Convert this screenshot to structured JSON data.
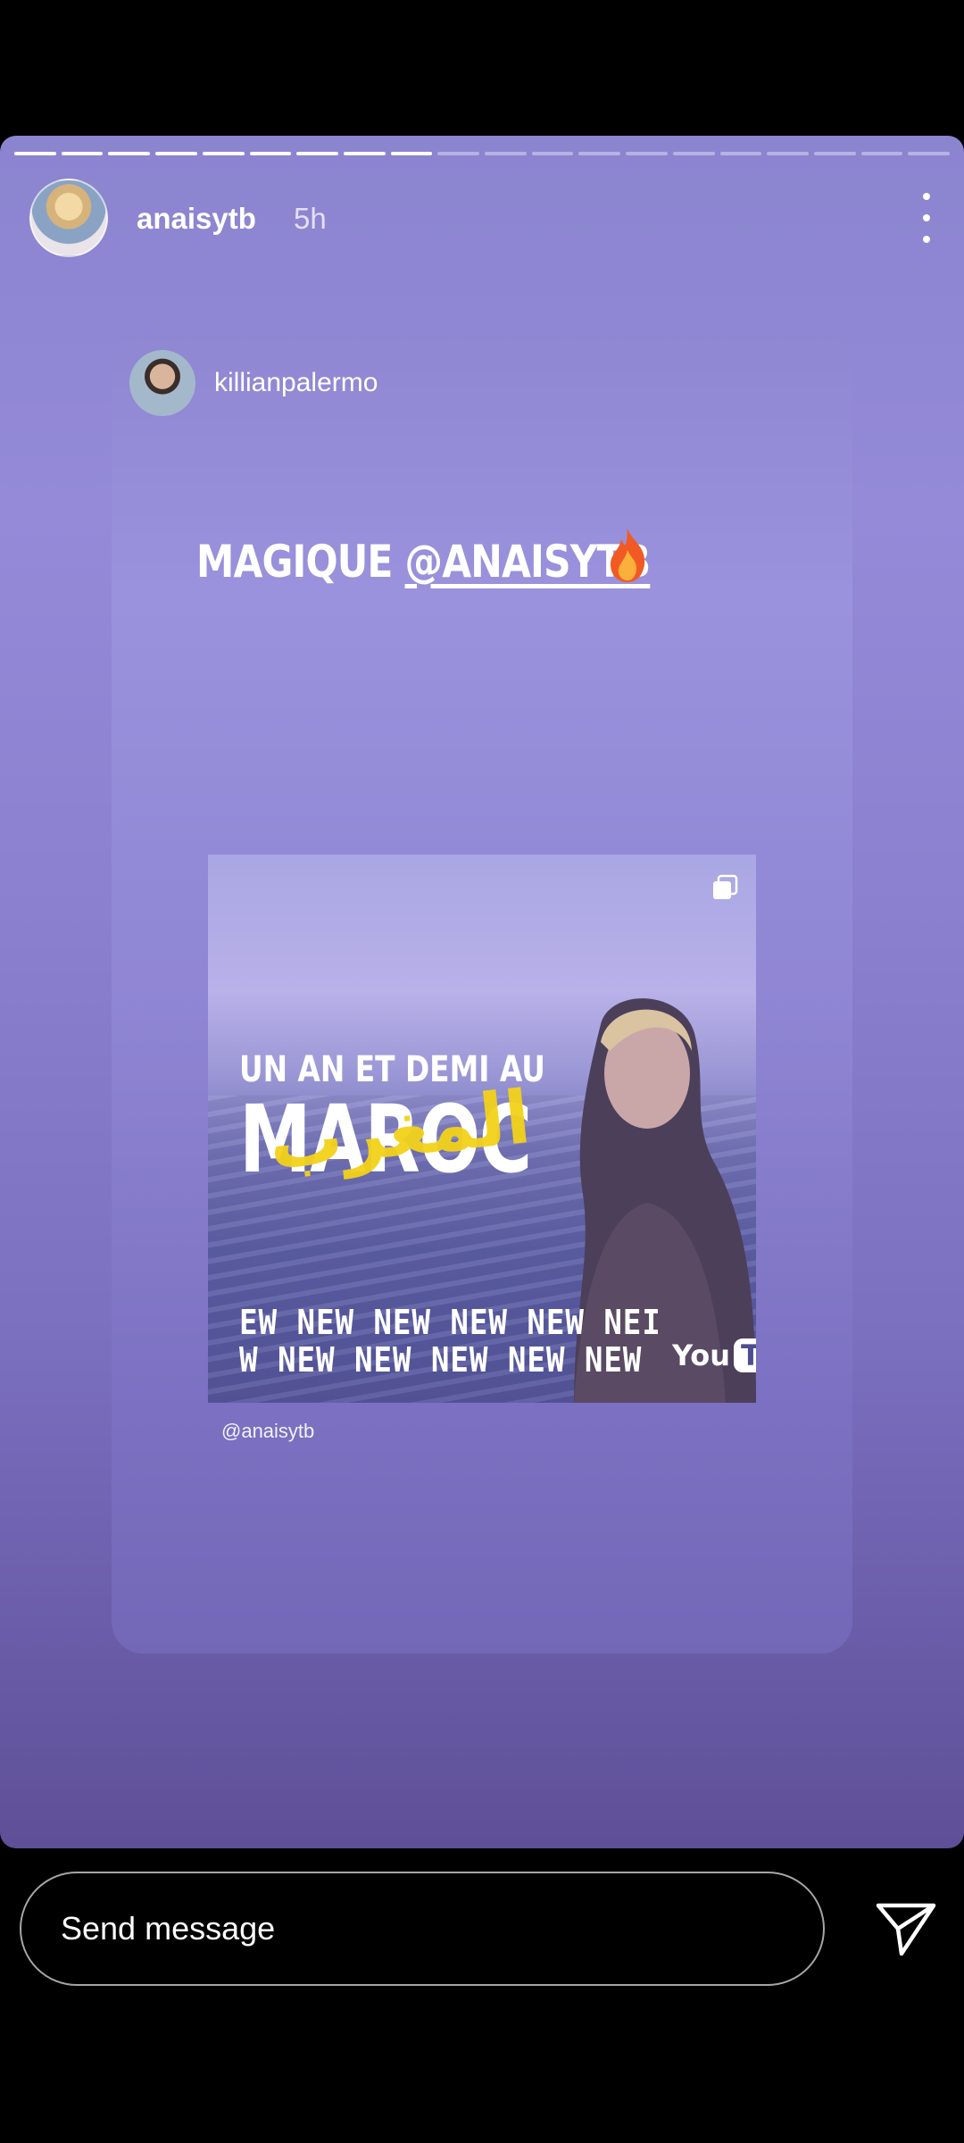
{
  "story": {
    "username": "anaisytb",
    "time_ago": "5h",
    "progress": {
      "total_segments": 20,
      "completed_segments": 9
    }
  },
  "shared_post": {
    "username": "killianpalermo",
    "caption_prefix": "MAGIQUE ",
    "caption_mention": "@ANAISYTB",
    "post": {
      "subtitle": "UN AN ET DEMI AU",
      "title": "MAROC",
      "arabic_title": "المغرب",
      "ticker_line1": "EW NEW NEW NEW NEW NEI",
      "ticker_line2": "W NEW NEW NEW NEW NEW",
      "youtube_you": "You",
      "youtube_tube": "Tube"
    },
    "credit_handle": "@anaisytb"
  },
  "reply": {
    "placeholder": "Send message"
  },
  "icons": {
    "more": "more-vertical-icon",
    "send": "send-paper-plane-icon",
    "fire": "fire-emoji-icon",
    "multi_post": "copy-icon"
  }
}
